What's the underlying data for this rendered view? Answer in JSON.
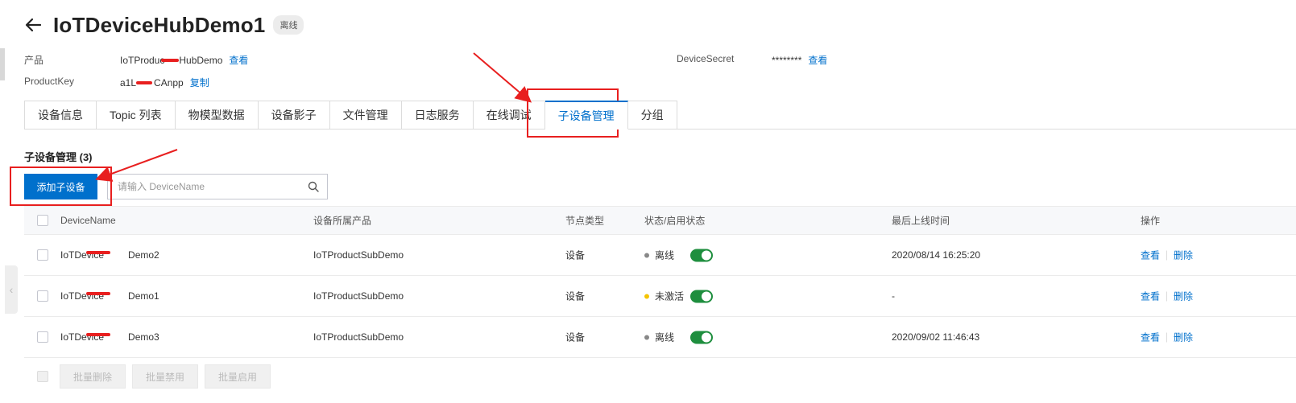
{
  "header": {
    "title": "IoTDeviceHubDemo1",
    "status_badge": "离线"
  },
  "info": {
    "product_label": "产品",
    "product_value_prefix": "IoTProduc",
    "product_value_suffix": "HubDemo",
    "product_link": "查看",
    "productkey_label": "ProductKey",
    "productkey_value_prefix": "a1L",
    "productkey_value_suffix": "CAnpp",
    "productkey_link": "复制",
    "secret_label": "DeviceSecret",
    "secret_value": "********",
    "secret_link": "查看"
  },
  "tabs": [
    "设备信息",
    "Topic 列表",
    "物模型数据",
    "设备影子",
    "文件管理",
    "日志服务",
    "在线调试",
    "子设备管理",
    "分组"
  ],
  "active_tab": "子设备管理",
  "section": {
    "title": "子设备管理 (3)"
  },
  "toolbar": {
    "add_button": "添加子设备",
    "search_placeholder": "请输入 DeviceName"
  },
  "table": {
    "columns": [
      "DeviceName",
      "设备所属产品",
      "节点类型",
      "状态/启用状态",
      "最后上线时间",
      "操作"
    ],
    "rows": [
      {
        "name_prefix": "IoTDevice",
        "name_suffix": "Demo2",
        "product": "IoTProductSubDemo",
        "node_type": "设备",
        "status": "离线",
        "status_color": "#888888",
        "enabled": true,
        "last_online": "2020/08/14 16:25:20",
        "view": "查看",
        "delete": "删除"
      },
      {
        "name_prefix": "IoTDevice",
        "name_suffix": "Demo1",
        "product": "IoTProductSubDemo",
        "node_type": "设备",
        "status": "未激活",
        "status_color": "#f5c400",
        "enabled": true,
        "last_online": "-",
        "view": "查看",
        "delete": "删除"
      },
      {
        "name_prefix": "IoTDevice",
        "name_suffix": "Demo3",
        "product": "IoTProductSubDemo",
        "node_type": "设备",
        "status": "离线",
        "status_color": "#888888",
        "enabled": true,
        "last_online": "2020/09/02 11:46:43",
        "view": "查看",
        "delete": "删除"
      }
    ]
  },
  "footer": {
    "batch_delete": "批量删除",
    "batch_disable": "批量禁用",
    "batch_enable": "批量启用"
  },
  "colors": {
    "primary": "#0070cc",
    "toggle_on": "#1e8e3e",
    "annotation_red": "#e81f1f"
  }
}
